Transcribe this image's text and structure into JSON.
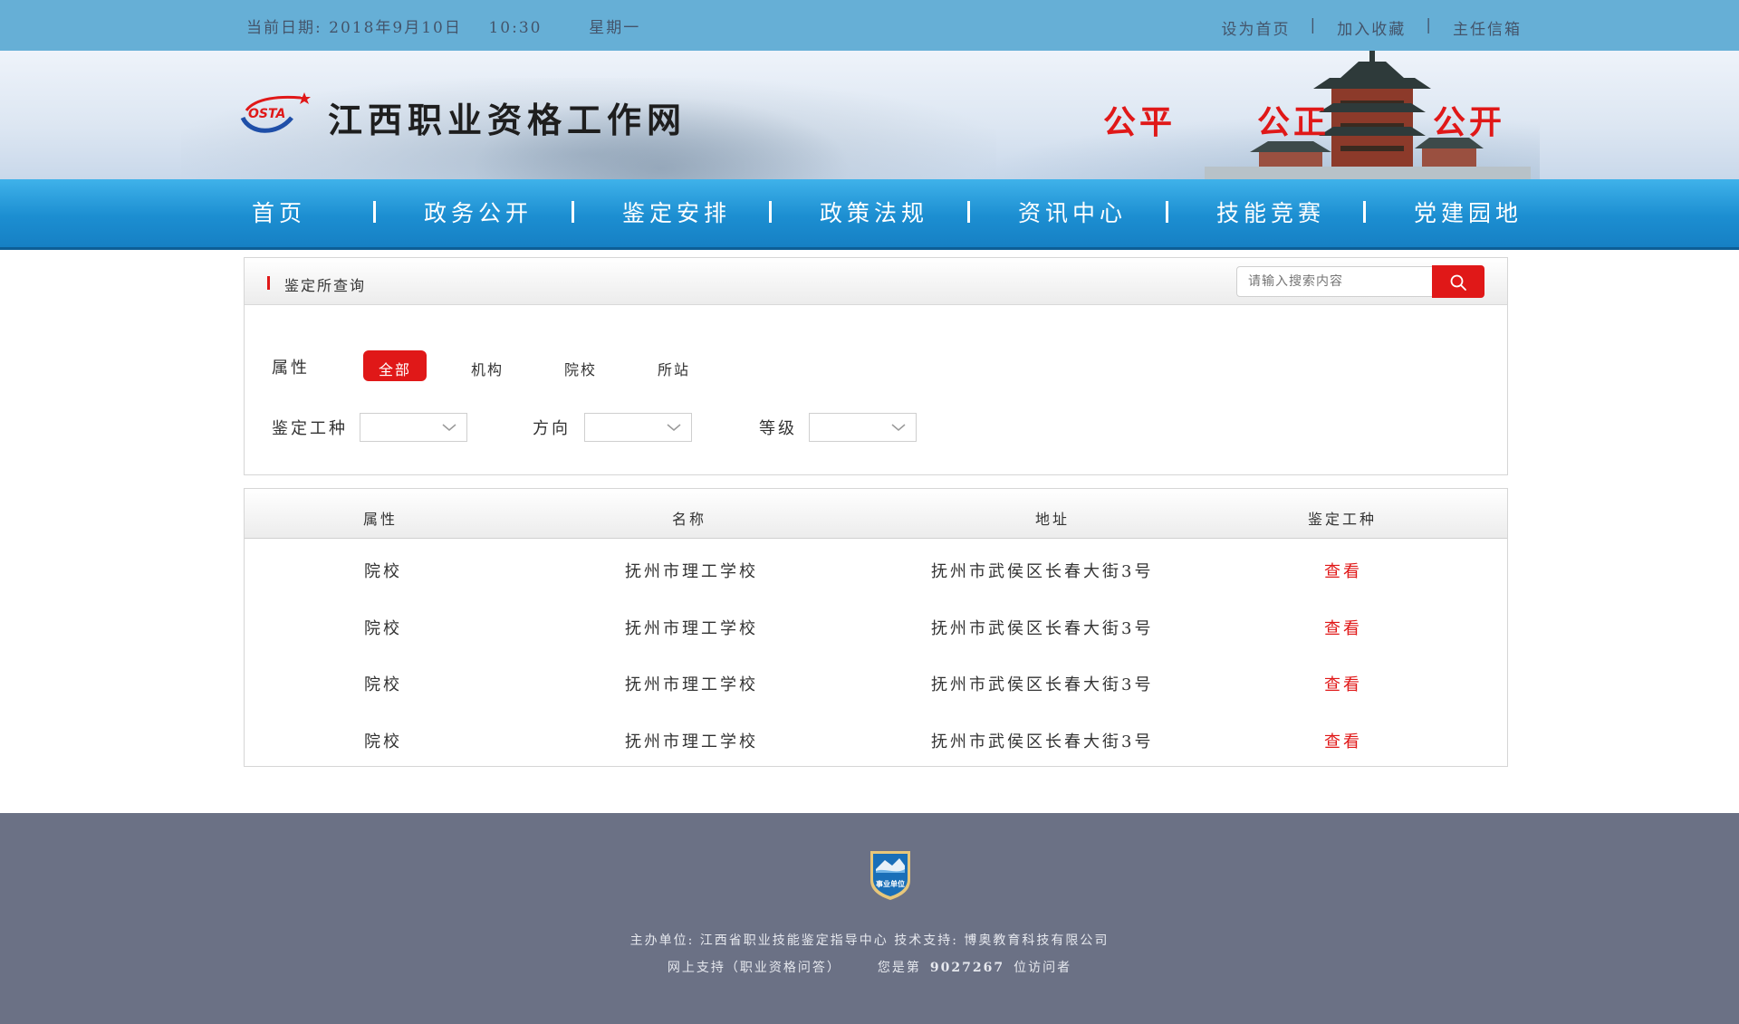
{
  "topbar": {
    "date": "当前日期: 2018年9月10日    10:30       星期一",
    "links": [
      "设为首页",
      "加入收藏",
      "主任信箱"
    ],
    "separator": "|"
  },
  "banner": {
    "site_title": "江西职业资格工作网",
    "logo_text": "OSTA",
    "slogans": [
      "公平",
      "公正",
      "公开"
    ]
  },
  "nav": {
    "items": [
      "首页",
      "政务公开",
      "鉴定安排",
      "政策法规",
      "资讯中心",
      "技能竞赛",
      "党建园地"
    ]
  },
  "query": {
    "title": "鉴定所查询",
    "search_placeholder": "请输入搜索内容",
    "attr_label": "属性",
    "attr_options": [
      "全部",
      "机构",
      "院校",
      "所站"
    ],
    "attr_selected": "全部",
    "type_label": "鉴定工种",
    "direction_label": "方向",
    "level_label": "等级"
  },
  "table": {
    "headers": [
      "属性",
      "名称",
      "地址",
      "鉴定工种"
    ],
    "rows": [
      {
        "attr": "院校",
        "name": "抚州市理工学校",
        "address": "抚州市武侯区长春大街3号",
        "action": "查看"
      },
      {
        "attr": "院校",
        "name": "抚州市理工学校",
        "address": "抚州市武侯区长春大街3号",
        "action": "查看"
      },
      {
        "attr": "院校",
        "name": "抚州市理工学校",
        "address": "抚州市武侯区长春大街3号",
        "action": "查看"
      },
      {
        "attr": "院校",
        "name": "抚州市理工学校",
        "address": "抚州市武侯区长春大街3号",
        "action": "查看"
      }
    ]
  },
  "footer": {
    "badge_text": "事业单位",
    "line1": "主办单位: 江西省职业技能鉴定指导中心  技术支持: 博奥教育科技有限公司",
    "support": "网上支持（职业资格问答）",
    "visitor_prefix": "您是第",
    "visitor_count": "9027267",
    "visitor_suffix": "位访问者"
  },
  "colors": {
    "accent_red": "#e01818",
    "topbar_blue": "#66afd6",
    "nav_blue": "#1c8ed1",
    "footer_gray": "#6b7185"
  }
}
